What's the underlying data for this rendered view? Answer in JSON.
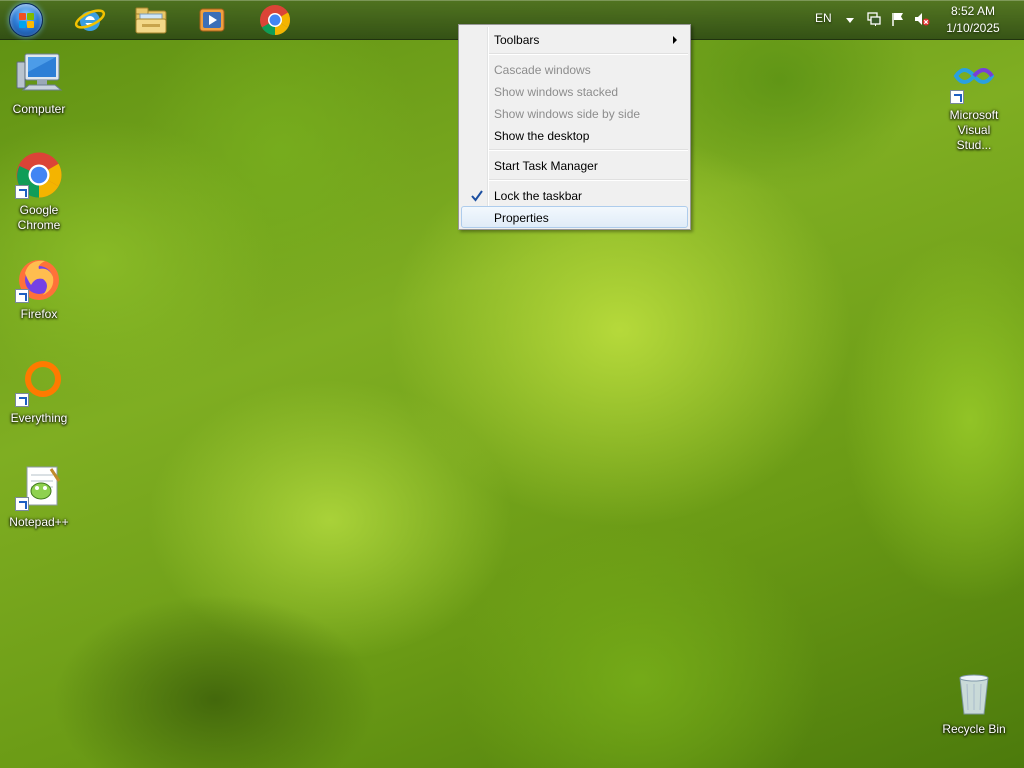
{
  "taskbar": {
    "start_button": "start-orb",
    "pinned": [
      {
        "name": "Internet Explorer",
        "icon": "ie-icon"
      },
      {
        "name": "Windows Explorer",
        "icon": "folder-icon"
      },
      {
        "name": "Windows Media Player",
        "icon": "media-player-icon"
      },
      {
        "name": "Google Chrome",
        "icon": "chrome-icon"
      }
    ],
    "tray": {
      "language": "EN",
      "time": "8:52 AM",
      "date": "1/10/2025"
    }
  },
  "context_menu": {
    "items": [
      {
        "label": "Toolbars",
        "enabled": true,
        "submenu": true
      },
      {
        "label": "Cascade windows",
        "enabled": false
      },
      {
        "label": "Show windows stacked",
        "enabled": false
      },
      {
        "label": "Show windows side by side",
        "enabled": false
      },
      {
        "label": "Show the desktop",
        "enabled": true
      },
      {
        "label": "Start Task Manager",
        "enabled": true
      },
      {
        "label": "Lock the taskbar",
        "enabled": true,
        "checked": true
      },
      {
        "label": "Properties",
        "enabled": true,
        "highlighted": true
      }
    ]
  },
  "desktop": {
    "icons": [
      {
        "label": "Computer",
        "icon": "computer-icon"
      },
      {
        "label": "Google Chrome",
        "icon": "chrome-icon"
      },
      {
        "label": "Firefox",
        "icon": "firefox-icon"
      },
      {
        "label": "Everything",
        "icon": "everything-icon"
      },
      {
        "label": "Notepad++",
        "icon": "notepadpp-icon"
      },
      {
        "label": "Microsoft Visual Stud...",
        "icon": "visual-studio-icon"
      },
      {
        "label": "Recycle Bin",
        "icon": "recycle-bin-icon"
      }
    ]
  },
  "colors": {
    "menu_background": "#f0f0f0",
    "menu_highlight_border": "#aeccec",
    "disabled_text": "#8d8d8d"
  }
}
